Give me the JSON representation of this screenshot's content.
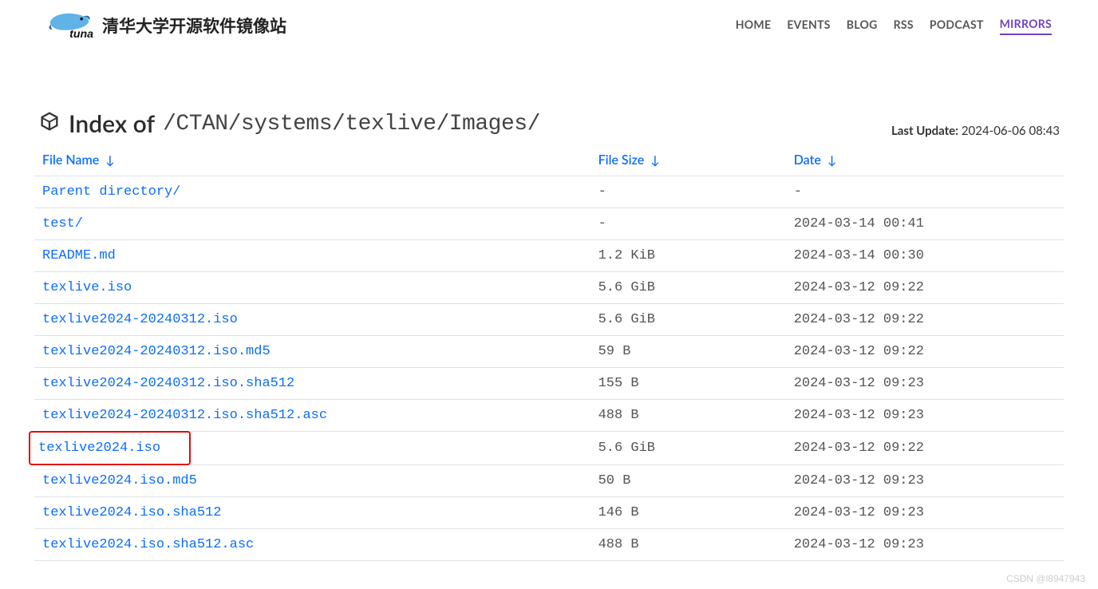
{
  "site": {
    "title": "清华大学开源软件镜像站"
  },
  "nav": {
    "items": [
      "HOME",
      "EVENTS",
      "BLOG",
      "RSS",
      "PODCAST",
      "MIRRORS"
    ],
    "active_index": 5
  },
  "page": {
    "heading_prefix": "Index of",
    "path": "/CTAN/systems/texlive/Images/",
    "last_update_label": "Last Update:",
    "last_update_value": "2024-06-06 08:43"
  },
  "columns": {
    "name": "File Name",
    "size": "File Size",
    "date": "Date",
    "arrow": "↓"
  },
  "rows": [
    {
      "name": "Parent directory/",
      "size": "-",
      "date": "-",
      "hl": false
    },
    {
      "name": "test/",
      "size": "-",
      "date": "2024-03-14 00:41",
      "hl": false
    },
    {
      "name": "README.md",
      "size": "1.2 KiB",
      "date": "2024-03-14 00:30",
      "hl": false
    },
    {
      "name": "texlive.iso",
      "size": "5.6 GiB",
      "date": "2024-03-12 09:22",
      "hl": false
    },
    {
      "name": "texlive2024-20240312.iso",
      "size": "5.6 GiB",
      "date": "2024-03-12 09:22",
      "hl": false
    },
    {
      "name": "texlive2024-20240312.iso.md5",
      "size": "59 B",
      "date": "2024-03-12 09:22",
      "hl": false
    },
    {
      "name": "texlive2024-20240312.iso.sha512",
      "size": "155 B",
      "date": "2024-03-12 09:23",
      "hl": false
    },
    {
      "name": "texlive2024-20240312.iso.sha512.asc",
      "size": "488 B",
      "date": "2024-03-12 09:23",
      "hl": false
    },
    {
      "name": "texlive2024.iso",
      "size": "5.6 GiB",
      "date": "2024-03-12 09:22",
      "hl": true
    },
    {
      "name": "texlive2024.iso.md5",
      "size": "50 B",
      "date": "2024-03-12 09:23",
      "hl": false
    },
    {
      "name": "texlive2024.iso.sha512",
      "size": "146 B",
      "date": "2024-03-12 09:23",
      "hl": false
    },
    {
      "name": "texlive2024.iso.sha512.asc",
      "size": "488 B",
      "date": "2024-03-12 09:23",
      "hl": false
    }
  ],
  "watermark": "CSDN @l8947943"
}
